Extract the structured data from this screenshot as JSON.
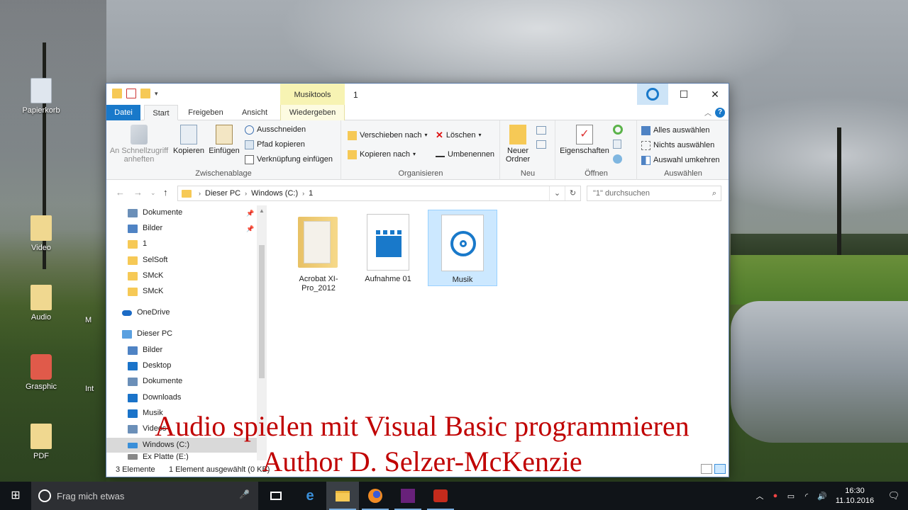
{
  "desktop": {
    "icons": [
      {
        "label": "Papierkorb",
        "icon": "recycle-bin-icon",
        "color": "#dfe6ee"
      },
      {
        "label": "Video",
        "icon": "video-folder-icon",
        "color": "#f0d890"
      },
      {
        "label": "Audio",
        "icon": "audio-folder-icon",
        "color": "#f0d890"
      },
      {
        "label": "Grasphic",
        "icon": "graphic-app-icon",
        "color": "#e05a4a"
      },
      {
        "label": "PDF",
        "icon": "pdf-folder-icon",
        "color": "#f0d890"
      }
    ],
    "partial_labels": [
      "M",
      "Int"
    ]
  },
  "window": {
    "title": "1",
    "context_tab": "Musiktools",
    "tabs": {
      "file": "Datei",
      "start": "Start",
      "share": "Freigeben",
      "view": "Ansicht",
      "play": "Wiedergeben"
    },
    "ribbon": {
      "clipboard": {
        "group_label": "Zwischenablage",
        "pin": "An Schnellzugriff anheften",
        "copy": "Kopieren",
        "paste": "Einfügen",
        "cut": "Ausschneiden",
        "copy_path": "Pfad kopieren",
        "paste_shortcut": "Verknüpfung einfügen"
      },
      "organize": {
        "group_label": "Organisieren",
        "move_to": "Verschieben nach",
        "copy_to": "Kopieren nach",
        "delete": "Löschen",
        "rename": "Umbenennen"
      },
      "new": {
        "group_label": "Neu",
        "new_folder": "Neuer Ordner"
      },
      "open": {
        "group_label": "Öffnen",
        "properties": "Eigenschaften"
      },
      "select": {
        "group_label": "Auswählen",
        "select_all": "Alles auswählen",
        "select_none": "Nichts auswählen",
        "invert": "Auswahl umkehren"
      }
    },
    "address": {
      "crumbs": [
        "Dieser PC",
        "Windows (C:)",
        "1"
      ],
      "search_placeholder": "\"1\" durchsuchen"
    },
    "nav": {
      "quick": [
        {
          "label": "Dokumente",
          "color": "#6b8fb8",
          "pinned": true
        },
        {
          "label": "Bilder",
          "color": "#4f83c4",
          "pinned": true
        },
        {
          "label": "1",
          "color": "#f6c956",
          "pinned": false
        },
        {
          "label": "SelSoft",
          "color": "#f6c956",
          "pinned": false
        },
        {
          "label": "SMcK",
          "color": "#f6c956",
          "pinned": false
        },
        {
          "label": "SMcK",
          "color": "#f6c956",
          "pinned": false
        }
      ],
      "onedrive": "OneDrive",
      "thispc": "Dieser PC",
      "pc_items": [
        {
          "label": "Bilder",
          "color": "#4f83c4"
        },
        {
          "label": "Desktop",
          "color": "#1a73c9"
        },
        {
          "label": "Dokumente",
          "color": "#6b8fb8"
        },
        {
          "label": "Downloads",
          "color": "#1a73c9"
        },
        {
          "label": "Musik",
          "color": "#1a73c9"
        },
        {
          "label": "Videos",
          "color": "#6b8fb8"
        },
        {
          "label": "Windows (C:)",
          "color": "#3a8fd9"
        },
        {
          "label": "Ex Platte (E:)",
          "color": "#888888"
        }
      ]
    },
    "files": [
      {
        "label": "Acrobat XI-Pro_2012",
        "type": "folder"
      },
      {
        "label": "Aufnahme 01",
        "type": "video"
      },
      {
        "label": "Musik",
        "type": "audio",
        "selected": true
      }
    ],
    "status": {
      "count": "3 Elemente",
      "selection": "1 Element ausgewählt (0 KB)"
    }
  },
  "overlay": {
    "line1": "Audio spielen mit Visual Basic programmieren",
    "line2": "Author D. Selzer-McKenzie"
  },
  "taskbar": {
    "search_placeholder": "Frag mich etwas",
    "time": "16:30",
    "date": "11.10.2016"
  }
}
